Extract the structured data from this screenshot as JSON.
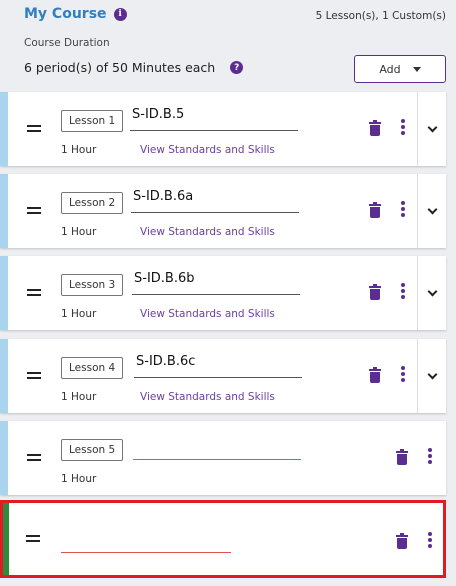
{
  "header": {
    "title": "My Course",
    "summary": "5 Lesson(s), 1 Custom(s)",
    "duration_label": "Course Duration",
    "duration_value": "6 period(s) of 50 Minutes each",
    "add_label": "Add"
  },
  "lessons": [
    {
      "label": "Lesson 1",
      "code": "S-ID.B.5",
      "duration": "1 Hour",
      "link": "View Standards and Skills"
    },
    {
      "label": "Lesson 2",
      "code": "S-ID.B.6a",
      "duration": "1 Hour",
      "link": "View Standards and Skills"
    },
    {
      "label": "Lesson 3",
      "code": "S-ID.B.6b",
      "duration": "1 Hour",
      "link": "View Standards and Skills"
    },
    {
      "label": "Lesson 4",
      "code": "S-ID.B.6c",
      "duration": "1 Hour",
      "link": "View Standards and Skills"
    },
    {
      "label": "Lesson 5",
      "code": "",
      "duration": "1 Hour"
    }
  ],
  "colors": {
    "accent": "#5c2d91",
    "title_blue": "#2f7fc1",
    "card_stripe": "#a9d4ee",
    "new_stripe": "#2e8b3d",
    "highlight": "#e01b24",
    "empty_underline": "#d9534f"
  },
  "icons": {
    "info": "info-icon",
    "help": "help-icon",
    "drag": "drag-handle-icon",
    "delete": "trash-icon",
    "more": "kebab-menu-icon",
    "expand": "chevron-down-icon"
  }
}
